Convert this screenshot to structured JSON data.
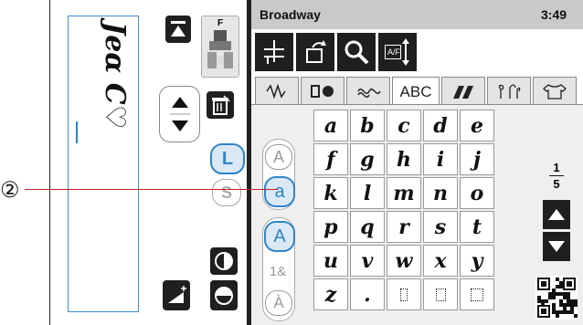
{
  "preview": {
    "text": "Jeɑ̃ C♡",
    "text_display": "Jeɑ C♡"
  },
  "presser_foot": "F",
  "left_buttons": {
    "large_L": "L",
    "small_S": "S"
  },
  "header": {
    "title": "Broadway",
    "time": "3:49"
  },
  "toolbar": [
    "needle-icon",
    "mirror-icon",
    "magnify-icon",
    "spacing-icon"
  ],
  "toolbar_spacing_label": "A/F",
  "tabs": [
    "stitch-tab",
    "buttonhole-tab",
    "decorative-tab",
    "ABC",
    "satin-tab",
    "plant-tab",
    "shirt-tab"
  ],
  "case_buttons": {
    "upper_a": "A",
    "lower_a": "a",
    "upper_A": "A",
    "nums": "1&",
    "accent": "À"
  },
  "keys": [
    [
      "a",
      "b",
      "c",
      "d",
      "e"
    ],
    [
      "f",
      "g",
      "h",
      "i",
      "j"
    ],
    [
      "k",
      "l",
      "m",
      "n",
      "o"
    ],
    [
      "p",
      "q",
      "r",
      "s",
      "t"
    ],
    [
      "u",
      "v",
      "w",
      "x",
      "y"
    ],
    [
      "z",
      ".",
      "",
      "",
      ""
    ]
  ],
  "page": {
    "current": "1",
    "total": "5"
  },
  "callout": "②"
}
